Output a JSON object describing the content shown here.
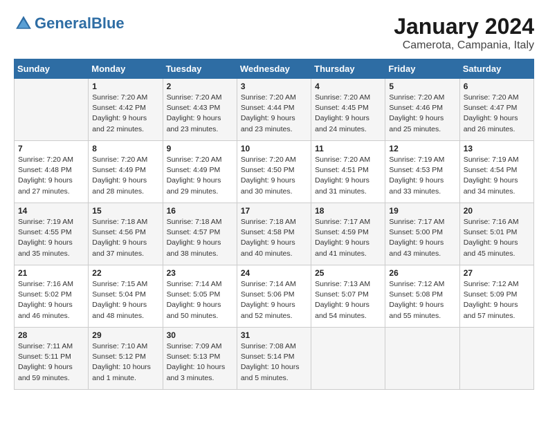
{
  "logo": {
    "text_general": "General",
    "text_blue": "Blue"
  },
  "header": {
    "month": "January 2024",
    "location": "Camerota, Campania, Italy"
  },
  "days_of_week": [
    "Sunday",
    "Monday",
    "Tuesday",
    "Wednesday",
    "Thursday",
    "Friday",
    "Saturday"
  ],
  "weeks": [
    [
      {
        "day": "",
        "sunrise": "",
        "sunset": "",
        "daylight": ""
      },
      {
        "day": "1",
        "sunrise": "Sunrise: 7:20 AM",
        "sunset": "Sunset: 4:42 PM",
        "daylight": "Daylight: 9 hours and 22 minutes."
      },
      {
        "day": "2",
        "sunrise": "Sunrise: 7:20 AM",
        "sunset": "Sunset: 4:43 PM",
        "daylight": "Daylight: 9 hours and 23 minutes."
      },
      {
        "day": "3",
        "sunrise": "Sunrise: 7:20 AM",
        "sunset": "Sunset: 4:44 PM",
        "daylight": "Daylight: 9 hours and 23 minutes."
      },
      {
        "day": "4",
        "sunrise": "Sunrise: 7:20 AM",
        "sunset": "Sunset: 4:45 PM",
        "daylight": "Daylight: 9 hours and 24 minutes."
      },
      {
        "day": "5",
        "sunrise": "Sunrise: 7:20 AM",
        "sunset": "Sunset: 4:46 PM",
        "daylight": "Daylight: 9 hours and 25 minutes."
      },
      {
        "day": "6",
        "sunrise": "Sunrise: 7:20 AM",
        "sunset": "Sunset: 4:47 PM",
        "daylight": "Daylight: 9 hours and 26 minutes."
      }
    ],
    [
      {
        "day": "7",
        "sunrise": "Sunrise: 7:20 AM",
        "sunset": "Sunset: 4:48 PM",
        "daylight": "Daylight: 9 hours and 27 minutes."
      },
      {
        "day": "8",
        "sunrise": "Sunrise: 7:20 AM",
        "sunset": "Sunset: 4:49 PM",
        "daylight": "Daylight: 9 hours and 28 minutes."
      },
      {
        "day": "9",
        "sunrise": "Sunrise: 7:20 AM",
        "sunset": "Sunset: 4:49 PM",
        "daylight": "Daylight: 9 hours and 29 minutes."
      },
      {
        "day": "10",
        "sunrise": "Sunrise: 7:20 AM",
        "sunset": "Sunset: 4:50 PM",
        "daylight": "Daylight: 9 hours and 30 minutes."
      },
      {
        "day": "11",
        "sunrise": "Sunrise: 7:20 AM",
        "sunset": "Sunset: 4:51 PM",
        "daylight": "Daylight: 9 hours and 31 minutes."
      },
      {
        "day": "12",
        "sunrise": "Sunrise: 7:19 AM",
        "sunset": "Sunset: 4:53 PM",
        "daylight": "Daylight: 9 hours and 33 minutes."
      },
      {
        "day": "13",
        "sunrise": "Sunrise: 7:19 AM",
        "sunset": "Sunset: 4:54 PM",
        "daylight": "Daylight: 9 hours and 34 minutes."
      }
    ],
    [
      {
        "day": "14",
        "sunrise": "Sunrise: 7:19 AM",
        "sunset": "Sunset: 4:55 PM",
        "daylight": "Daylight: 9 hours and 35 minutes."
      },
      {
        "day": "15",
        "sunrise": "Sunrise: 7:18 AM",
        "sunset": "Sunset: 4:56 PM",
        "daylight": "Daylight: 9 hours and 37 minutes."
      },
      {
        "day": "16",
        "sunrise": "Sunrise: 7:18 AM",
        "sunset": "Sunset: 4:57 PM",
        "daylight": "Daylight: 9 hours and 38 minutes."
      },
      {
        "day": "17",
        "sunrise": "Sunrise: 7:18 AM",
        "sunset": "Sunset: 4:58 PM",
        "daylight": "Daylight: 9 hours and 40 minutes."
      },
      {
        "day": "18",
        "sunrise": "Sunrise: 7:17 AM",
        "sunset": "Sunset: 4:59 PM",
        "daylight": "Daylight: 9 hours and 41 minutes."
      },
      {
        "day": "19",
        "sunrise": "Sunrise: 7:17 AM",
        "sunset": "Sunset: 5:00 PM",
        "daylight": "Daylight: 9 hours and 43 minutes."
      },
      {
        "day": "20",
        "sunrise": "Sunrise: 7:16 AM",
        "sunset": "Sunset: 5:01 PM",
        "daylight": "Daylight: 9 hours and 45 minutes."
      }
    ],
    [
      {
        "day": "21",
        "sunrise": "Sunrise: 7:16 AM",
        "sunset": "Sunset: 5:02 PM",
        "daylight": "Daylight: 9 hours and 46 minutes."
      },
      {
        "day": "22",
        "sunrise": "Sunrise: 7:15 AM",
        "sunset": "Sunset: 5:04 PM",
        "daylight": "Daylight: 9 hours and 48 minutes."
      },
      {
        "day": "23",
        "sunrise": "Sunrise: 7:14 AM",
        "sunset": "Sunset: 5:05 PM",
        "daylight": "Daylight: 9 hours and 50 minutes."
      },
      {
        "day": "24",
        "sunrise": "Sunrise: 7:14 AM",
        "sunset": "Sunset: 5:06 PM",
        "daylight": "Daylight: 9 hours and 52 minutes."
      },
      {
        "day": "25",
        "sunrise": "Sunrise: 7:13 AM",
        "sunset": "Sunset: 5:07 PM",
        "daylight": "Daylight: 9 hours and 54 minutes."
      },
      {
        "day": "26",
        "sunrise": "Sunrise: 7:12 AM",
        "sunset": "Sunset: 5:08 PM",
        "daylight": "Daylight: 9 hours and 55 minutes."
      },
      {
        "day": "27",
        "sunrise": "Sunrise: 7:12 AM",
        "sunset": "Sunset: 5:09 PM",
        "daylight": "Daylight: 9 hours and 57 minutes."
      }
    ],
    [
      {
        "day": "28",
        "sunrise": "Sunrise: 7:11 AM",
        "sunset": "Sunset: 5:11 PM",
        "daylight": "Daylight: 9 hours and 59 minutes."
      },
      {
        "day": "29",
        "sunrise": "Sunrise: 7:10 AM",
        "sunset": "Sunset: 5:12 PM",
        "daylight": "Daylight: 10 hours and 1 minute."
      },
      {
        "day": "30",
        "sunrise": "Sunrise: 7:09 AM",
        "sunset": "Sunset: 5:13 PM",
        "daylight": "Daylight: 10 hours and 3 minutes."
      },
      {
        "day": "31",
        "sunrise": "Sunrise: 7:08 AM",
        "sunset": "Sunset: 5:14 PM",
        "daylight": "Daylight: 10 hours and 5 minutes."
      },
      {
        "day": "",
        "sunrise": "",
        "sunset": "",
        "daylight": ""
      },
      {
        "day": "",
        "sunrise": "",
        "sunset": "",
        "daylight": ""
      },
      {
        "day": "",
        "sunrise": "",
        "sunset": "",
        "daylight": ""
      }
    ]
  ]
}
